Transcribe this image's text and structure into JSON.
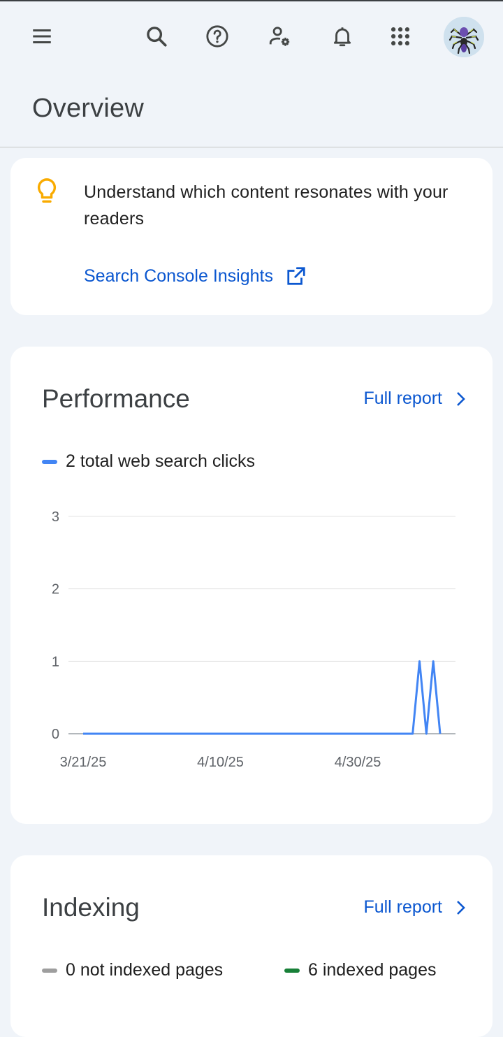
{
  "header": {
    "menu_icon": "menu-icon",
    "search_icon": "search-icon",
    "help_icon": "help-icon",
    "admin_icon": "person-settings-icon",
    "notifications_icon": "bell-icon",
    "apps_icon": "apps-grid-icon"
  },
  "page": {
    "title": "Overview"
  },
  "insights": {
    "text": "Understand which content resonates with your readers",
    "link_label": "Search Console Insights"
  },
  "performance": {
    "title": "Performance",
    "full_report": "Full report",
    "legend": "2 total web search clicks",
    "line_color": "#4285f4"
  },
  "chart_data": {
    "type": "line",
    "title": "",
    "xlabel": "",
    "ylabel": "",
    "ylim": [
      0,
      3
    ],
    "yticks": [
      "0",
      "1",
      "2",
      "3"
    ],
    "xticks": [
      "3/21/25",
      "4/10/25",
      "4/30/25"
    ],
    "grid": true,
    "series": [
      {
        "name": "web search clicks",
        "x": [
          "3/21/25",
          "3/22/25",
          "3/23/25",
          "3/24/25",
          "3/25/25",
          "3/26/25",
          "3/27/25",
          "3/28/25",
          "3/29/25",
          "3/30/25",
          "3/31/25",
          "4/1/25",
          "4/2/25",
          "4/3/25",
          "4/4/25",
          "4/5/25",
          "4/6/25",
          "4/7/25",
          "4/8/25",
          "4/9/25",
          "4/10/25",
          "4/11/25",
          "4/12/25",
          "4/13/25",
          "4/14/25",
          "4/15/25",
          "4/16/25",
          "4/17/25",
          "4/18/25",
          "4/19/25",
          "4/20/25",
          "4/21/25",
          "4/22/25",
          "4/23/25",
          "4/24/25",
          "4/25/25",
          "4/26/25",
          "4/27/25",
          "4/28/25",
          "4/29/25",
          "4/30/25",
          "5/1/25",
          "5/2/25",
          "5/3/25",
          "5/4/25",
          "5/5/25",
          "5/6/25",
          "5/7/25",
          "5/8/25",
          "5/9/25",
          "5/10/25",
          "5/11/25",
          "5/12/25"
        ],
        "values": [
          0,
          0,
          0,
          0,
          0,
          0,
          0,
          0,
          0,
          0,
          0,
          0,
          0,
          0,
          0,
          0,
          0,
          0,
          0,
          0,
          0,
          0,
          0,
          0,
          0,
          0,
          0,
          0,
          0,
          0,
          0,
          0,
          0,
          0,
          0,
          0,
          0,
          0,
          0,
          0,
          0,
          0,
          0,
          0,
          0,
          0,
          0,
          0,
          0,
          1,
          0,
          1,
          0
        ],
        "color": "#4285f4"
      }
    ]
  },
  "indexing": {
    "title": "Indexing",
    "full_report": "Full report",
    "legend_not_indexed": "0 not indexed pages",
    "legend_indexed": "6 indexed pages",
    "not_indexed_color": "#9e9e9e",
    "indexed_color": "#188038"
  },
  "colors": {
    "background": "#f0f4f9",
    "link": "#0b57d0",
    "bulb": "#f9ab00"
  }
}
